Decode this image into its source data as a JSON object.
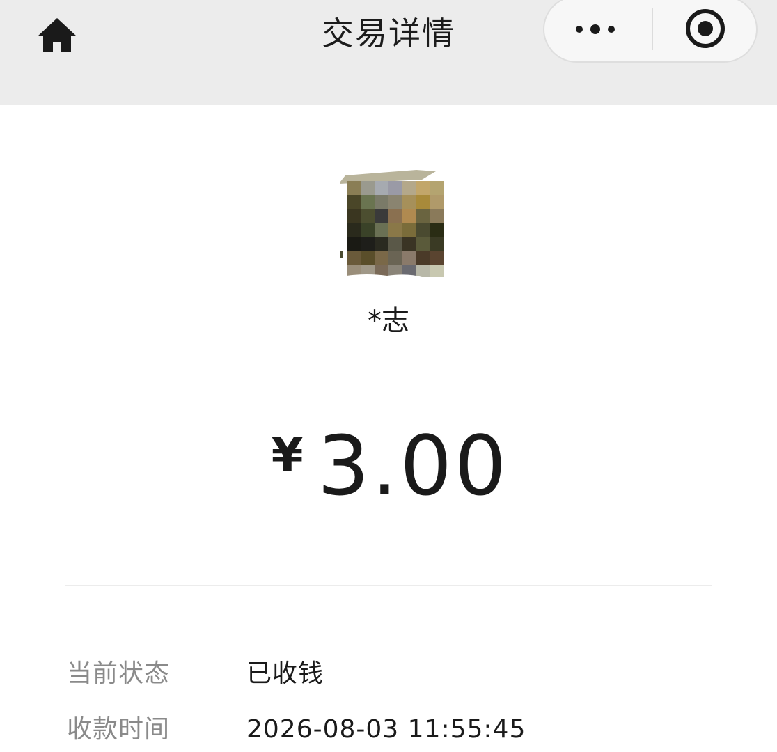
{
  "header": {
    "title": "交易详情",
    "home_icon": "home-icon",
    "more_icon": "more-dots-icon",
    "close_icon": "target-close-icon",
    "background": "#ececec"
  },
  "payer": {
    "name": "*志",
    "avatar": "avatar-image (pixelated)"
  },
  "amount": {
    "currency": "¥",
    "value": "3.00"
  },
  "details": [
    {
      "label": "当前状态",
      "value": "已收钱"
    },
    {
      "label": "收款时间",
      "value": "2026-08-03 11:55:45"
    }
  ]
}
